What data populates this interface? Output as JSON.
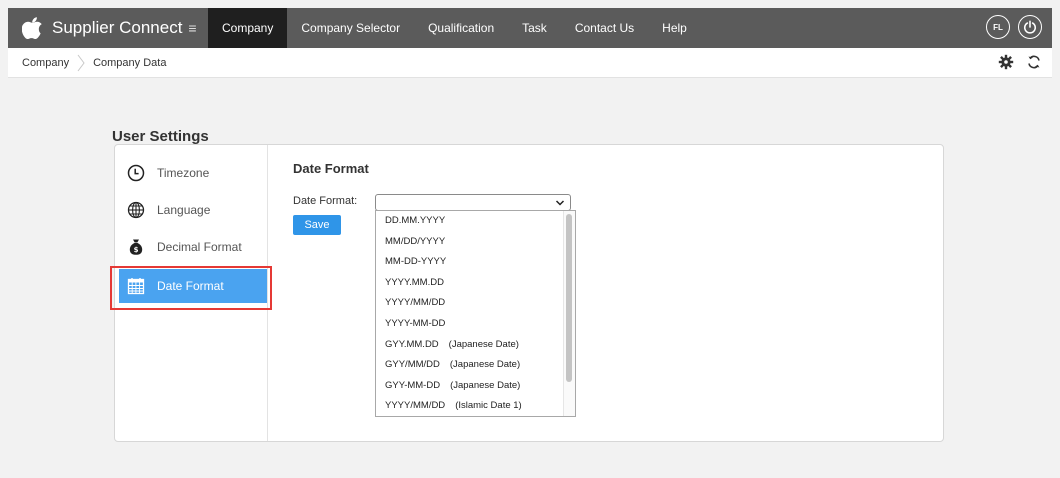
{
  "app": {
    "name": "Supplier Connect",
    "menu_glyph": "≡"
  },
  "nav": [
    {
      "label": "Company",
      "active": true
    },
    {
      "label": "Company Selector",
      "active": false
    },
    {
      "label": "Qualification",
      "active": false
    },
    {
      "label": "Task",
      "active": false
    },
    {
      "label": "Contact Us",
      "active": false
    },
    {
      "label": "Help",
      "active": false
    }
  ],
  "user": {
    "initials": "FL"
  },
  "breadcrumb": [
    "Company",
    "Company Data"
  ],
  "page": {
    "title": "User Settings"
  },
  "sidebar": {
    "items": [
      {
        "label": "Timezone",
        "icon": "clock-icon",
        "active": false
      },
      {
        "label": "Language",
        "icon": "globe-icon",
        "active": false
      },
      {
        "label": "Decimal Format",
        "icon": "money-bag-icon",
        "active": false
      },
      {
        "label": "Date Format",
        "icon": "calendar-icon",
        "active": true
      }
    ]
  },
  "content": {
    "title": "Date Format",
    "field_label": "Date Format:",
    "selected_value": "",
    "save_label": "Save",
    "options": [
      {
        "format": "DD.MM.YYYY",
        "note": ""
      },
      {
        "format": "MM/DD/YYYY",
        "note": ""
      },
      {
        "format": "MM-DD-YYYY",
        "note": ""
      },
      {
        "format": "YYYY.MM.DD",
        "note": ""
      },
      {
        "format": "YYYY/MM/DD",
        "note": ""
      },
      {
        "format": "YYYY-MM-DD",
        "note": ""
      },
      {
        "format": "GYY.MM.DD",
        "note": "(Japanese Date)"
      },
      {
        "format": "GYY/MM/DD",
        "note": "(Japanese Date)"
      },
      {
        "format": "GYY-MM-DD",
        "note": "(Japanese Date)"
      },
      {
        "format": "YYYY/MM/DD",
        "note": "(Islamic Date 1)"
      }
    ]
  },
  "colors": {
    "topbar": "#5b5b5b",
    "nav_active": "#1f1f1f",
    "accent": "#4aa3f0",
    "save": "#2f95e8",
    "highlight": "#e53935"
  }
}
